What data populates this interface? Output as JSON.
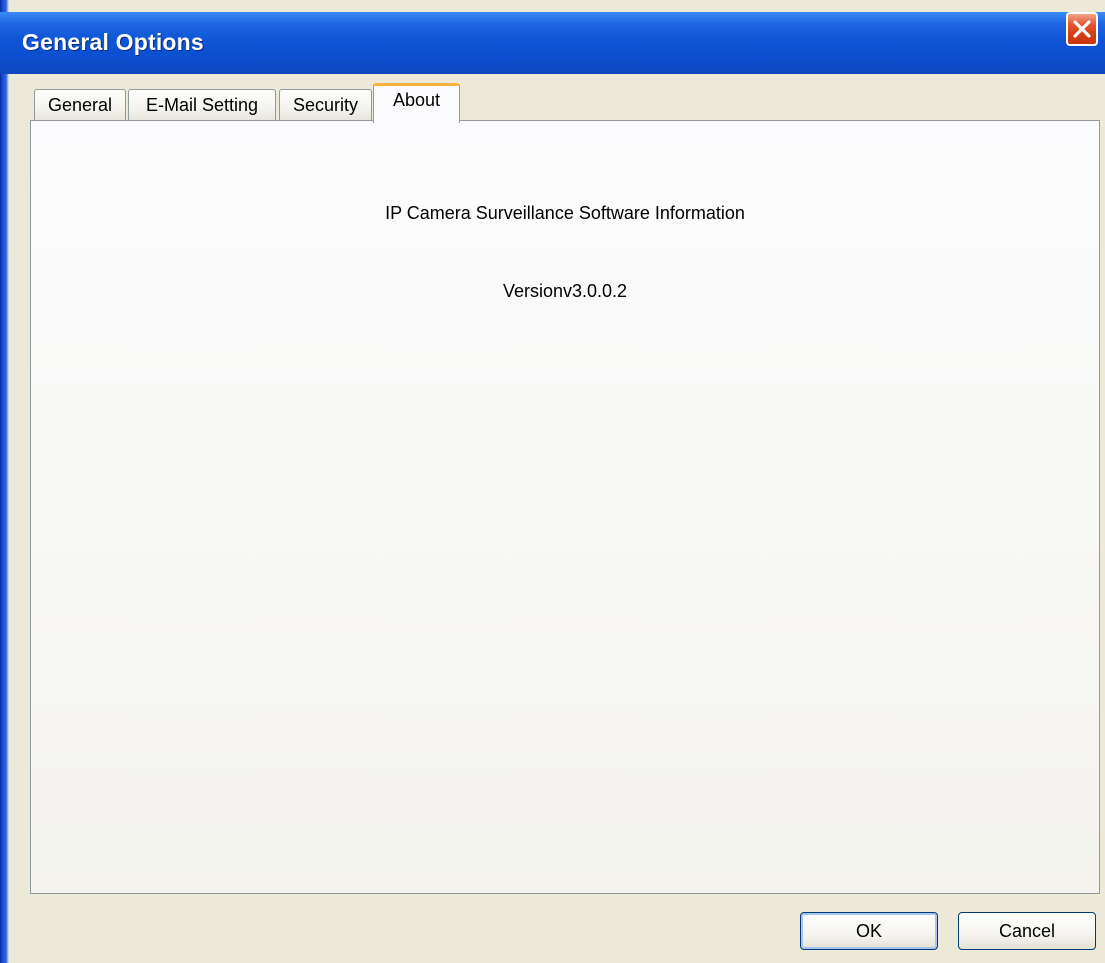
{
  "window": {
    "title": "General Options"
  },
  "tabs": [
    {
      "label": "General",
      "active": false
    },
    {
      "label": "E-Mail Setting",
      "active": false
    },
    {
      "label": "Security",
      "active": false
    },
    {
      "label": "About",
      "active": true
    }
  ],
  "about": {
    "info_title": "IP Camera Surveillance Software Information",
    "version": "Versionv3.0.0.2"
  },
  "buttons": {
    "ok_label": "OK",
    "cancel_label": "Cancel"
  },
  "icons": {
    "close": "close-icon"
  },
  "colors": {
    "titlebar": "#0c4fd0",
    "close_button": "#d43d14",
    "active_tab_highlight": "#f6b33c",
    "dialog_background": "#ece9d8"
  }
}
